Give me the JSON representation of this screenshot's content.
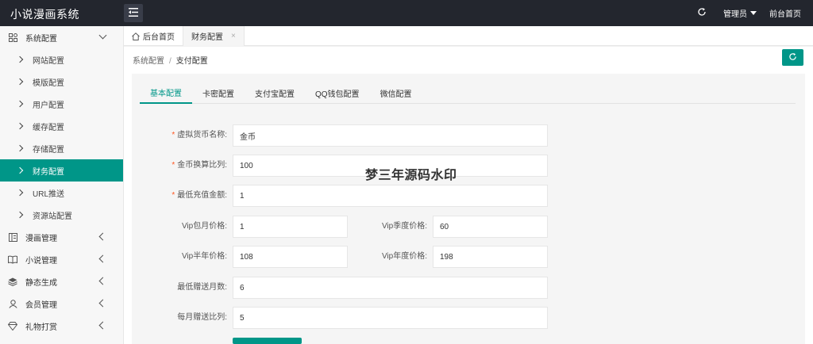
{
  "app": {
    "title": "小说漫画系统"
  },
  "topbar": {
    "admin_label": "管理员",
    "front_link": "前台首页"
  },
  "sidebar": {
    "items": [
      {
        "label": "系统配置",
        "type": "parent",
        "icon": "grid-settings-icon",
        "expanded": true
      },
      {
        "label": "网站配置",
        "type": "child"
      },
      {
        "label": "模版配置",
        "type": "child"
      },
      {
        "label": "用户配置",
        "type": "child"
      },
      {
        "label": "缓存配置",
        "type": "child"
      },
      {
        "label": "存储配置",
        "type": "child"
      },
      {
        "label": "财务配置",
        "type": "child",
        "active": true
      },
      {
        "label": "URL推送",
        "type": "child"
      },
      {
        "label": "资源站配置",
        "type": "child"
      },
      {
        "label": "漫画管理",
        "type": "parent",
        "icon": "comic-icon"
      },
      {
        "label": "小说管理",
        "type": "parent",
        "icon": "book-icon"
      },
      {
        "label": "静态生成",
        "type": "parent",
        "icon": "layers-icon"
      },
      {
        "label": "会员管理",
        "type": "parent",
        "icon": "user-icon"
      },
      {
        "label": "礼物打赏",
        "type": "parent",
        "icon": "diamond-icon"
      }
    ]
  },
  "page_tabs": [
    {
      "label": "后台首页"
    },
    {
      "label": "财务配置",
      "close": "×"
    }
  ],
  "breadcrumb": {
    "parent": "系统配置",
    "separator": "/",
    "current": "支付配置"
  },
  "inner_tabs": [
    "基本配置",
    "卡密配置",
    "支付宝配置",
    "QQ钱包配置",
    "微信配置"
  ],
  "form": {
    "required_mark": "*",
    "currency_name": {
      "label": "虚拟货币名称:",
      "value": "金币"
    },
    "exchange_rate": {
      "label": "金币换算比列:",
      "value": "100"
    },
    "min_recharge": {
      "label": "最低充值金额:",
      "value": "1"
    },
    "vip_month": {
      "label": "Vip包月价格:",
      "value": "1"
    },
    "vip_quarter": {
      "label": "Vip季度价格:",
      "value": "60"
    },
    "vip_half_year": {
      "label": "Vip半年价格:",
      "value": "108"
    },
    "vip_year": {
      "label": "Vip年度价格:",
      "value": "198"
    },
    "min_gift_months": {
      "label": "最低赠送月数:",
      "value": "6"
    },
    "monthly_gift_ratio": {
      "label": "每月赠送比列:",
      "value": "5"
    }
  },
  "watermark": "梦三年源码水印",
  "colors": {
    "accent": "#009688",
    "topbar": "#23262e",
    "required": "#ff5722"
  }
}
